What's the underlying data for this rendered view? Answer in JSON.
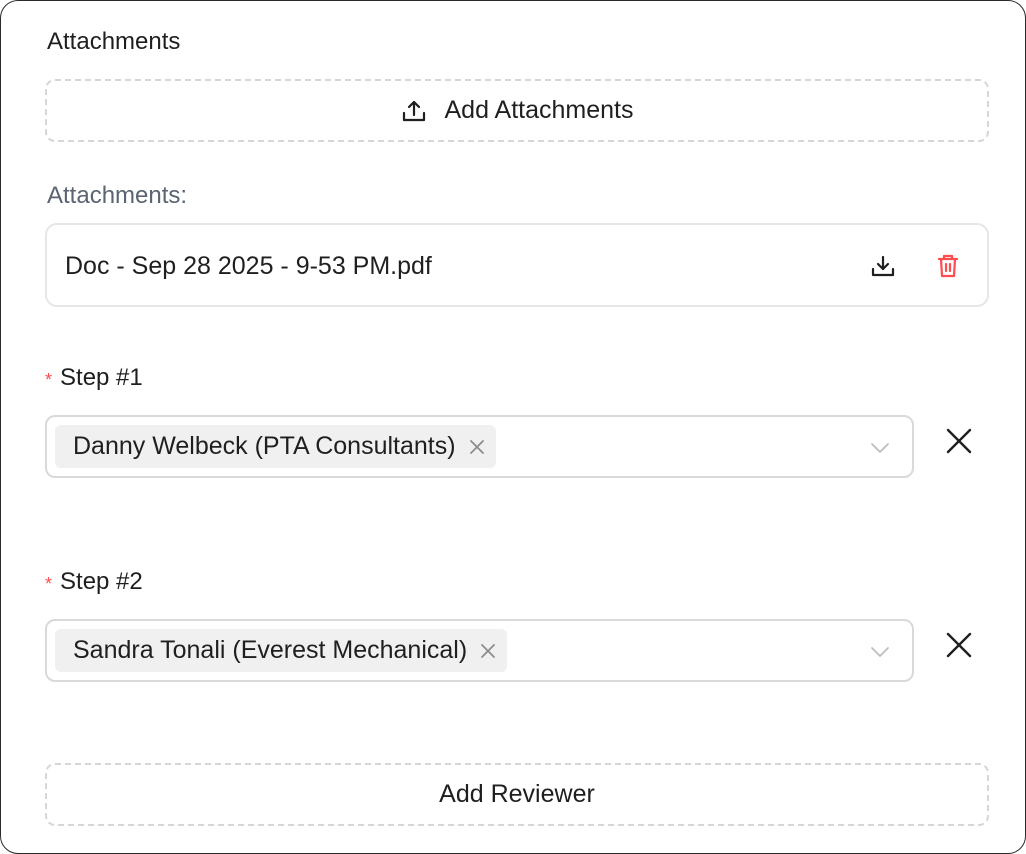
{
  "attachments_section": {
    "title": "Attachments",
    "add_button_label": "Add Attachments",
    "add_button_icon": "upload-icon",
    "list_label": "Attachments:",
    "files": [
      {
        "name": "Doc - Sep 28 2025 - 9-53 PM.pdf",
        "download_icon": "download-icon",
        "delete_icon": "trash-icon"
      }
    ]
  },
  "steps": [
    {
      "required_marker": "*",
      "label": "Step #1",
      "selected": [
        "Danny Welbeck (PTA Consultants)"
      ]
    },
    {
      "required_marker": "*",
      "label": "Step #2",
      "selected": [
        "Sandra Tonali (Everest Mechanical)"
      ]
    }
  ],
  "add_reviewer_label": "Add Reviewer",
  "colors": {
    "danger": "#ff4d4f",
    "muted_label": "#5b6472",
    "dashed_border": "#d6d6d6",
    "tag_bg": "#f0f0f0"
  }
}
